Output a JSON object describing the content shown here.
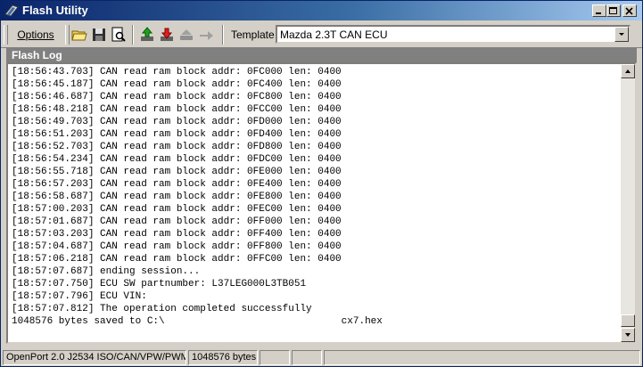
{
  "window": {
    "title": "Flash Utility"
  },
  "toolbar": {
    "options_label": "Options",
    "icons": [
      "open-folder-icon",
      "save-disk-icon",
      "print-preview-icon",
      "read-green-icon",
      "write-red-icon",
      "action-gray-icon",
      "action-gray-2-icon"
    ],
    "template_label": "Template",
    "template_value": "Mazda 2.3T CAN ECU"
  },
  "section": {
    "title": "Flash Log"
  },
  "log": [
    "[18:56:43.703] CAN read ram block addr: 0FC000 len: 0400",
    "[18:56:45.187] CAN read ram block addr: 0FC400 len: 0400",
    "[18:56:46.687] CAN read ram block addr: 0FC800 len: 0400",
    "[18:56:48.218] CAN read ram block addr: 0FCC00 len: 0400",
    "[18:56:49.703] CAN read ram block addr: 0FD000 len: 0400",
    "[18:56:51.203] CAN read ram block addr: 0FD400 len: 0400",
    "[18:56:52.703] CAN read ram block addr: 0FD800 len: 0400",
    "[18:56:54.234] CAN read ram block addr: 0FDC00 len: 0400",
    "[18:56:55.718] CAN read ram block addr: 0FE000 len: 0400",
    "[18:56:57.203] CAN read ram block addr: 0FE400 len: 0400",
    "[18:56:58.687] CAN read ram block addr: 0FE800 len: 0400",
    "[18:57:00.203] CAN read ram block addr: 0FEC00 len: 0400",
    "[18:57:01.687] CAN read ram block addr: 0FF000 len: 0400",
    "[18:57:03.203] CAN read ram block addr: 0FF400 len: 0400",
    "[18:57:04.687] CAN read ram block addr: 0FF800 len: 0400",
    "[18:57:06.218] CAN read ram block addr: 0FFC00 len: 0400",
    "[18:57:07.687] ending session...",
    "[18:57:07.750] ECU SW partnumber: L37LEG000L3TB051",
    "[18:57:07.796] ECU VIN:",
    "[18:57:07.812] The operation completed successfully",
    "1048576 bytes saved to C:\\                              cx7.hex"
  ],
  "status": {
    "interface": "OpenPort 2.0 J2534 ISO/CAN/VPW/PWM",
    "size": "1048576 bytes",
    "panel3": "",
    "panel4": "",
    "panel5": ""
  },
  "colors": {
    "title_gradient_start": "#0a246a",
    "title_gradient_end": "#a6caf0",
    "face": "#d4d0c8",
    "header": "#808080"
  }
}
